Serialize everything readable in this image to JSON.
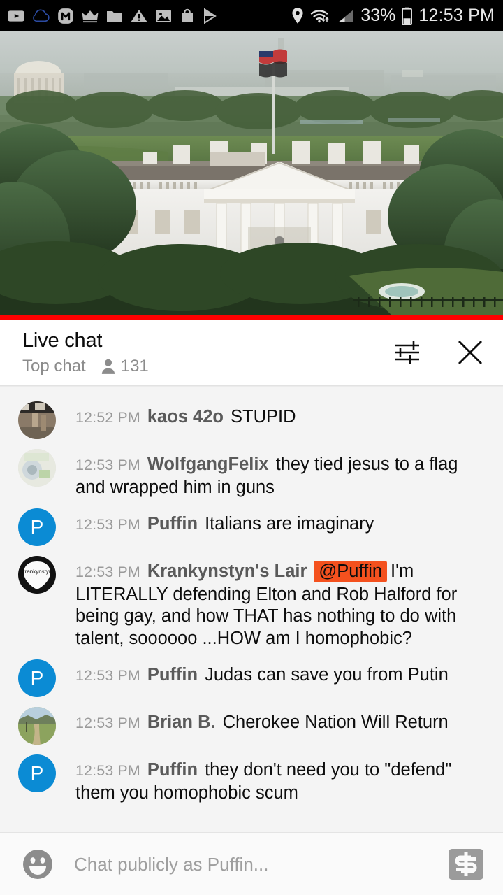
{
  "statusbar": {
    "left_icons": [
      {
        "name": "youtube-icon",
        "label": "YouTube"
      },
      {
        "name": "cloud-icon",
        "label": "Cloud"
      },
      {
        "name": "messenger-icon",
        "label": "Messenger"
      },
      {
        "name": "crown-icon",
        "label": "Crown"
      },
      {
        "name": "folder-icon",
        "label": "Folder"
      },
      {
        "name": "warning-icon",
        "label": "Warning"
      },
      {
        "name": "photo-icon",
        "label": "Photo"
      },
      {
        "name": "shopping-bag-icon",
        "label": "Shopping bag"
      },
      {
        "name": "play-store-icon",
        "label": "Play Store"
      }
    ],
    "right_icons": [
      {
        "name": "location-icon",
        "label": "Location"
      },
      {
        "name": "wifi-icon",
        "label": "Wi-Fi"
      },
      {
        "name": "signal-icon",
        "label": "Cellular signal"
      },
      {
        "name": "battery-icon",
        "label": "Battery"
      }
    ],
    "battery_percent": "33%",
    "clock": "12:53 PM"
  },
  "video": {
    "alt": "Live stream of the White House with US flag and Jefferson Memorial in the distance",
    "progress_color": "#ff0000",
    "progress_percent": 100
  },
  "chat_header": {
    "title": "Live chat",
    "mode": "Top chat",
    "viewer_count": "131",
    "viewer_icon": "person-icon",
    "settings_icon": "chat-settings-sliders-icon",
    "close_icon": "close-icon"
  },
  "messages": [
    {
      "time": "12:52 PM",
      "author": "kaos 42o",
      "mention": "",
      "text": "STUPID",
      "avatar_type": "photo-dark",
      "avatar_letter": ""
    },
    {
      "time": "12:53 PM",
      "author": "WolfgangFelix",
      "mention": "",
      "text": "they tied jesus to a flag and wrapped him in guns",
      "avatar_type": "photo-pale",
      "avatar_letter": ""
    },
    {
      "time": "12:53 PM",
      "author": "Puffin",
      "mention": "",
      "text": "Italians are imaginary",
      "avatar_type": "letter",
      "avatar_letter": "P"
    },
    {
      "time": "12:53 PM",
      "author": "Krankynstyn's Lair",
      "mention": "@Puffin",
      "text": "I'm LITERALLY defending Elton and Rob Halford for being gay, and how THAT has nothing to do with talent, soooooo ...HOW am I homophobic?",
      "avatar_type": "photo-pick",
      "avatar_letter": ""
    },
    {
      "time": "12:53 PM",
      "author": "Puffin",
      "mention": "",
      "text": "Judas can save you from Putin",
      "avatar_type": "letter",
      "avatar_letter": "P"
    },
    {
      "time": "12:53 PM",
      "author": "Brian B.",
      "mention": "",
      "text": "Cherokee Nation Will Return",
      "avatar_type": "photo-landscape",
      "avatar_letter": ""
    },
    {
      "time": "12:53 PM",
      "author": "Puffin",
      "mention": "",
      "text": "they don't need you to \"defend\" them you homophobic scum",
      "avatar_type": "letter",
      "avatar_letter": "P"
    }
  ],
  "input_bar": {
    "emoji_icon": "emoji-smiley-icon",
    "placeholder": "Chat publicly as Puffin...",
    "value": "",
    "superchat_icon": "super-chat-dollar-icon"
  },
  "colors": {
    "mention_highlight": "#f4511e",
    "avatar_blue": "#0b8bd4",
    "progress_red": "#ff0000",
    "chat_background": "#f4f4f4",
    "status_bar": "#000000"
  }
}
